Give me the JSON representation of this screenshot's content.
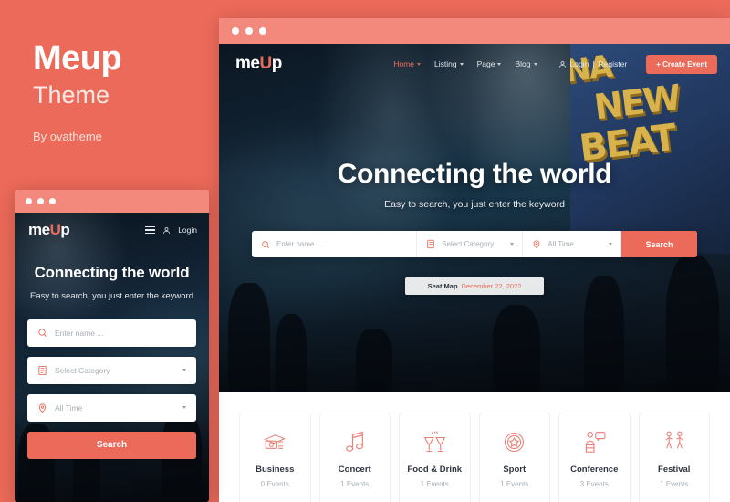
{
  "promo": {
    "title": "Meup",
    "subtitle": "Theme",
    "byline": "By ovatheme",
    "background_color": "#ec6a5a"
  },
  "accent_color": "#ec6a5a",
  "desktop": {
    "chrome": {
      "dots": [
        "dot-1",
        "dot-2",
        "dot-3"
      ]
    },
    "header": {
      "logo_prefix": "me",
      "logo_accent": "U",
      "logo_suffix": "p",
      "nav": [
        {
          "label": "Home",
          "caret": true,
          "active": true
        },
        {
          "label": "Listing",
          "caret": true,
          "active": false
        },
        {
          "label": "Page",
          "caret": true,
          "active": false
        },
        {
          "label": "Blog",
          "caret": true,
          "active": false
        }
      ],
      "login_label": "Login",
      "auth_separator": "|",
      "register_label": "Register",
      "create_event_label": "+ Create Event"
    },
    "hero": {
      "title": "Connecting the world",
      "subtitle": "Easy to search, you just enter the keyword",
      "graffiti": [
        "NA",
        "NEW",
        "BEAT"
      ]
    },
    "search": {
      "name_placeholder": "Enter name ...",
      "category_placeholder": "Select Category",
      "time_placeholder": "All Time",
      "button_label": "Search"
    },
    "seatmap": {
      "label": "Seat Map",
      "date": "December 22, 2022"
    },
    "categories": [
      {
        "name": "Business",
        "count": "0  Events",
        "icon": "money-icon"
      },
      {
        "name": "Concert",
        "count": "1  Events",
        "icon": "music-note-icon"
      },
      {
        "name": "Food & Drink",
        "count": "1  Events",
        "icon": "cheers-glasses-icon"
      },
      {
        "name": "Sport",
        "count": "1  Events",
        "icon": "medal-icon"
      },
      {
        "name": "Conference",
        "count": "3  Events",
        "icon": "speaker-bubble-icon"
      },
      {
        "name": "Festival",
        "count": "1  Events",
        "icon": "dancers-icon"
      }
    ]
  },
  "mobile": {
    "chrome": {
      "dots": [
        "dot-1",
        "dot-2",
        "dot-3"
      ]
    },
    "header": {
      "logo_prefix": "me",
      "logo_accent": "U",
      "logo_suffix": "p",
      "login_label": "Login"
    },
    "hero": {
      "title": "Connecting the world",
      "subtitle": "Easy to search, you just enter the keyword"
    },
    "search": {
      "name_placeholder": "Enter name ...",
      "category_placeholder": "Select Category",
      "time_placeholder": "All Time",
      "button_label": "Search"
    }
  }
}
